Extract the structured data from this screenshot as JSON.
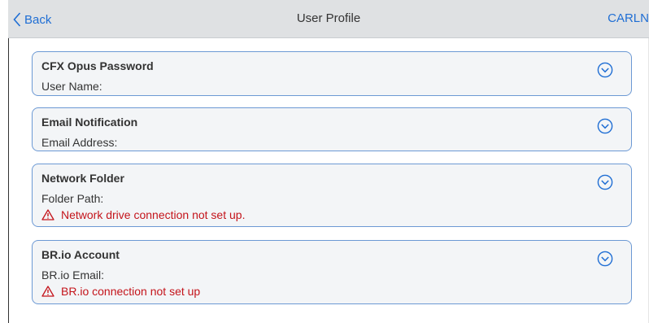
{
  "header": {
    "back_label": "Back",
    "title": "User Profile",
    "user": "CARLN"
  },
  "cards": [
    {
      "title": "CFX Opus Password",
      "field_label": "User Name:",
      "warning": ""
    },
    {
      "title": "Email Notification",
      "field_label": "Email Address:",
      "warning": ""
    },
    {
      "title": "Network Folder",
      "field_label": "Folder Path:",
      "warning": "Network drive connection not set up."
    },
    {
      "title": "BR.io Account",
      "field_label": "BR.io Email:",
      "warning": "BR.io connection not set up"
    }
  ],
  "icons": {
    "back": "chevron-left-icon",
    "expand": "chevron-down-circle-icon",
    "warning": "warning-triangle-icon"
  },
  "colors": {
    "accent": "#1f6ed4",
    "warning": "#c4141b",
    "card_border": "#6c99d4",
    "card_bg": "#f3f5f7",
    "header_bg": "#dfe1e3"
  }
}
